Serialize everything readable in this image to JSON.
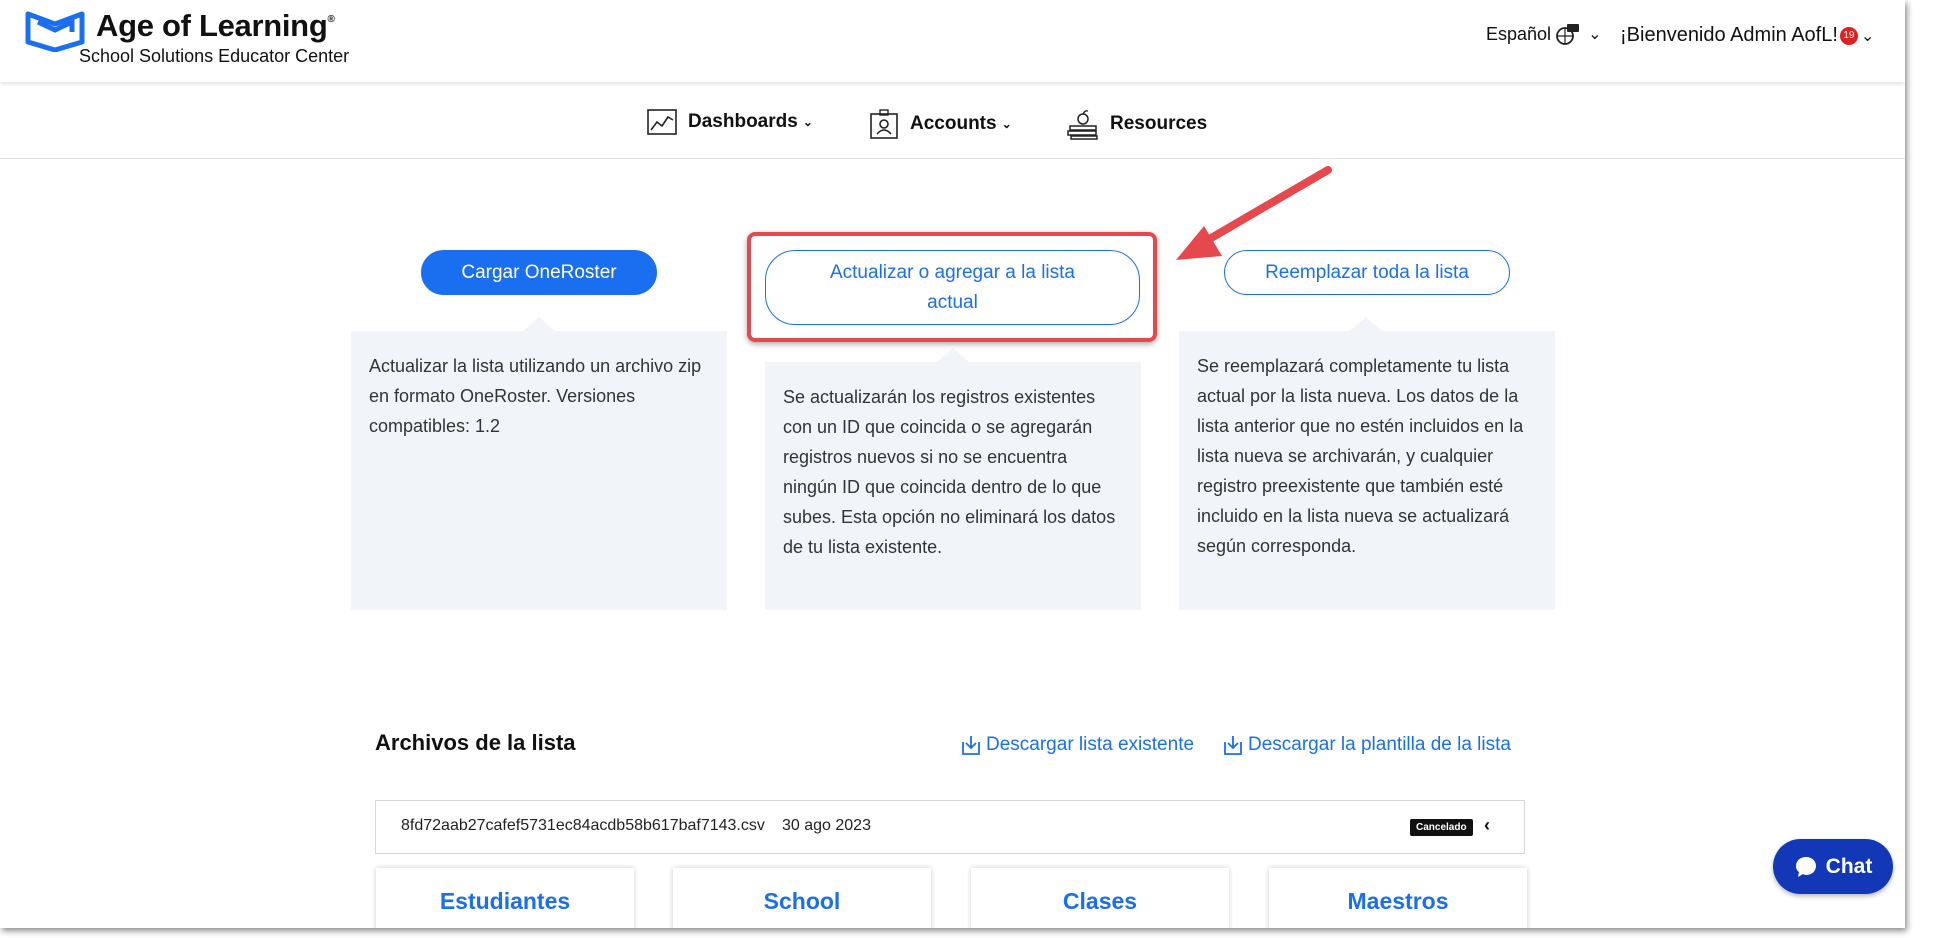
{
  "header": {
    "brand_title": "Age of Learning",
    "brand_mark": "®",
    "brand_subtitle": "School Solutions Educator Center",
    "language_label": "Español",
    "welcome_text": "¡Bienvenido Admin AofL!",
    "notification_count": "19"
  },
  "nav": {
    "dashboards": "Dashboards",
    "accounts": "Accounts",
    "resources": "Resources"
  },
  "options": {
    "oneroster_button": "Cargar OneRoster",
    "oneroster_desc": "Actualizar la lista utilizando un archivo zip en formato OneRoster. Versiones compatibles: 1.2",
    "update_button": "Actualizar o agregar a la lista actual",
    "update_desc": "Se actualizarán los registros existentes con un ID que coincida o se agregarán registros nuevos si no se encuentra ningún ID que coincida dentro de lo que subes. Esta opción no eliminará los datos de tu lista existente.",
    "replace_button": "Reemplazar toda la lista",
    "replace_desc": "Se reemplazará completamente tu lista actual por la lista nueva. Los datos de la lista anterior que no estén incluidos en la lista nueva se archivarán, y cualquier registro preexistente que también esté incluido en la lista nueva se actualizará según corresponda."
  },
  "files": {
    "title": "Archivos de la lista",
    "download_existing": "Descargar lista existente",
    "download_template": "Descargar la plantilla de la lista",
    "rows": [
      {
        "filename": "8fd72aab27cafef5731ec84acdb58b617baf7143.csv",
        "date": "30 ago 2023",
        "status": "Cancelado"
      }
    ],
    "tiles": [
      "Estudiantes",
      "School",
      "Clases",
      "Maestros"
    ]
  },
  "chat": {
    "label": "Chat"
  },
  "colors": {
    "accent": "#1a6ff0",
    "highlight": "#e5484d",
    "chat": "#1238b8",
    "card_bg": "#f1f5fa"
  }
}
